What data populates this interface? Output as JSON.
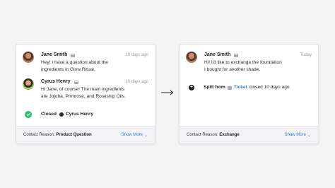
{
  "left_card": {
    "messages": [
      {
        "sender": "Jane Smith",
        "time": "10 days ago",
        "body_lines": [
          "Hey! I have a question about the",
          "ingredients in Glow Ritual."
        ]
      },
      {
        "sender": "Cyrus Henry",
        "time": "10 days ago",
        "body_lines": [
          "Hi Jane, of course! The main ingredients",
          "are Jojoba, Primrose, and Roseship Oils."
        ]
      }
    ],
    "status": {
      "label": "Closed",
      "by": "Cyrus Henry"
    },
    "footer": {
      "reason_label": "Contact Reason:",
      "reason_value": "Product Question",
      "show_more": "Show More"
    }
  },
  "right_card": {
    "messages": [
      {
        "sender": "Jane Smith",
        "time": "Today",
        "body_lines": [
          "Hi! I'd like to exchange the foundation",
          "I bought for another shade."
        ]
      }
    ],
    "split": {
      "label": "Split from",
      "link": "Ticket",
      "time": "closed 10 days ago"
    },
    "footer": {
      "reason_label": "Contact Reason:",
      "reason_value": "Exchange",
      "show_more": "Show More"
    }
  },
  "colors": {
    "link": "#2e7fd6",
    "closed": "#2fbf71",
    "background": "#f4f4f5"
  },
  "icons": {
    "email": "envelope-icon",
    "closed": "check-circle-icon",
    "user": "user-icon",
    "split": "split-plus-icon",
    "arrow": "arrow-right-icon"
  }
}
